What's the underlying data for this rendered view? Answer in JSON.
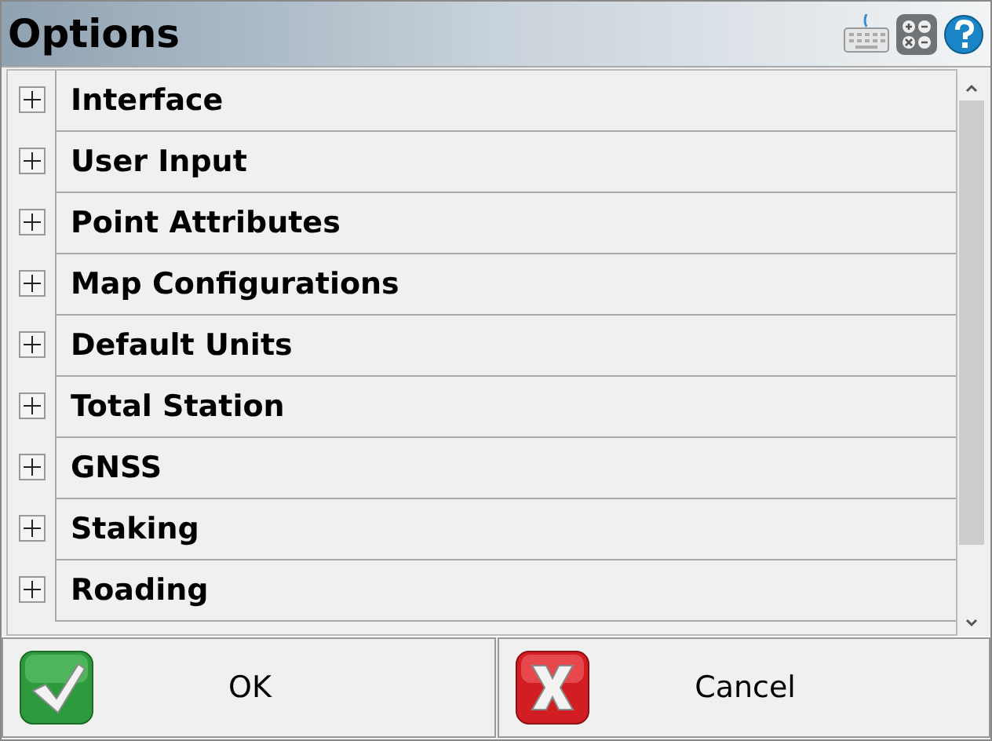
{
  "window": {
    "title": "Options"
  },
  "items": [
    {
      "label": "Interface",
      "expanded": false
    },
    {
      "label": "User Input",
      "expanded": false
    },
    {
      "label": "Point Attributes",
      "expanded": false
    },
    {
      "label": "Map Configurations",
      "expanded": false
    },
    {
      "label": "Default Units",
      "expanded": false
    },
    {
      "label": "Total Station",
      "expanded": false
    },
    {
      "label": "GNSS",
      "expanded": false
    },
    {
      "label": "Staking",
      "expanded": false
    },
    {
      "label": "Roading",
      "expanded": false
    }
  ],
  "buttons": [
    {
      "label": "OK",
      "kind": "ok"
    },
    {
      "label": "Cancel",
      "kind": "cancel"
    }
  ]
}
